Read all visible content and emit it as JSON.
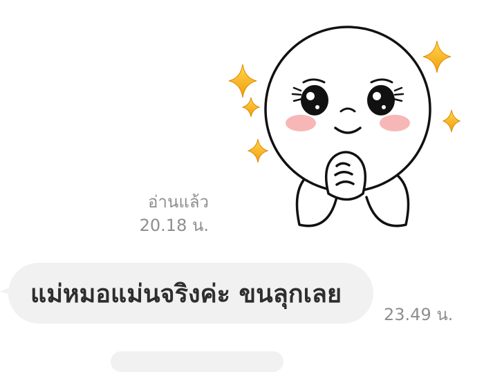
{
  "sticker": {
    "icon": "cute-face-praying-sticker"
  },
  "read_receipt": {
    "status": "อ่านแล้ว",
    "time": "20.18 น."
  },
  "message": {
    "text": "แม่หมอแม่นจริงค่ะ ขนลุกเลย",
    "time": "23.49 น."
  },
  "colors": {
    "bubble": "#f1f1f1",
    "meta_text": "#8e8e8e",
    "sparkle": "#f5b21a",
    "blush": "#f7b7b7"
  }
}
